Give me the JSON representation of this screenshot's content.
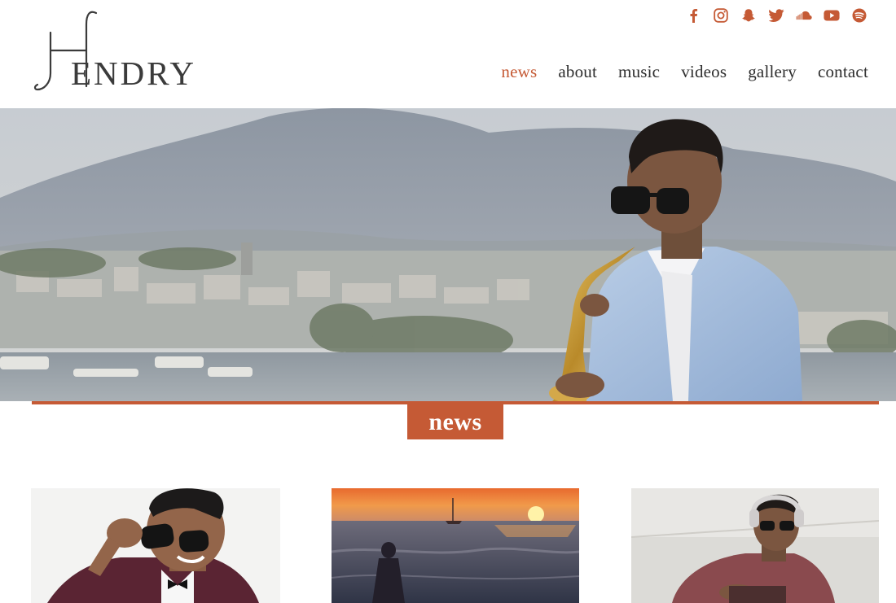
{
  "brand": {
    "logo_text": "ENDRY",
    "logo_alt": "Hendry"
  },
  "social": [
    {
      "name": "facebook-icon"
    },
    {
      "name": "instagram-icon"
    },
    {
      "name": "snapchat-icon"
    },
    {
      "name": "twitter-icon"
    },
    {
      "name": "soundcloud-icon"
    },
    {
      "name": "youtube-icon"
    },
    {
      "name": "spotify-icon"
    }
  ],
  "nav": {
    "items": [
      {
        "label": "news",
        "active": true
      },
      {
        "label": "about",
        "active": false
      },
      {
        "label": "music",
        "active": false
      },
      {
        "label": "videos",
        "active": false
      },
      {
        "label": "gallery",
        "active": false
      },
      {
        "label": "contact",
        "active": false
      }
    ]
  },
  "section": {
    "title": "news"
  },
  "colors": {
    "accent": "#c55a35",
    "text": "#2e2e2e",
    "background": "#ffffff"
  }
}
